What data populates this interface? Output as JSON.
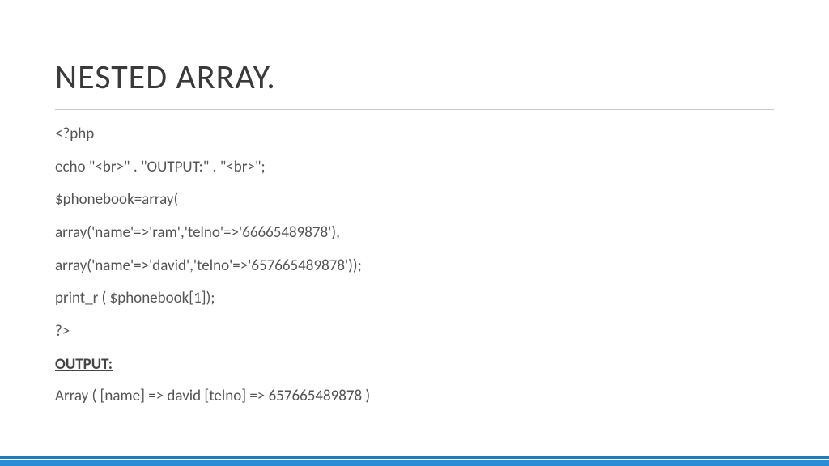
{
  "title": "NESTED ARRAY.",
  "code": {
    "l1": "<?php",
    "l2": "echo \"<br>\" . \"OUTPUT:\" . \"<br>\";",
    "l3": "$phonebook=array(",
    "l4": "array('name'=>'ram','telno'=>'66665489878'),",
    "l5": "array('name'=>'david','telno'=>'657665489878'));",
    "l6": "print_r ( $phonebook[1]);",
    "l7": "?>"
  },
  "output_label": "OUTPUT:",
  "output_text": "Array ( [name] => david [telno] => 657665489878 )"
}
